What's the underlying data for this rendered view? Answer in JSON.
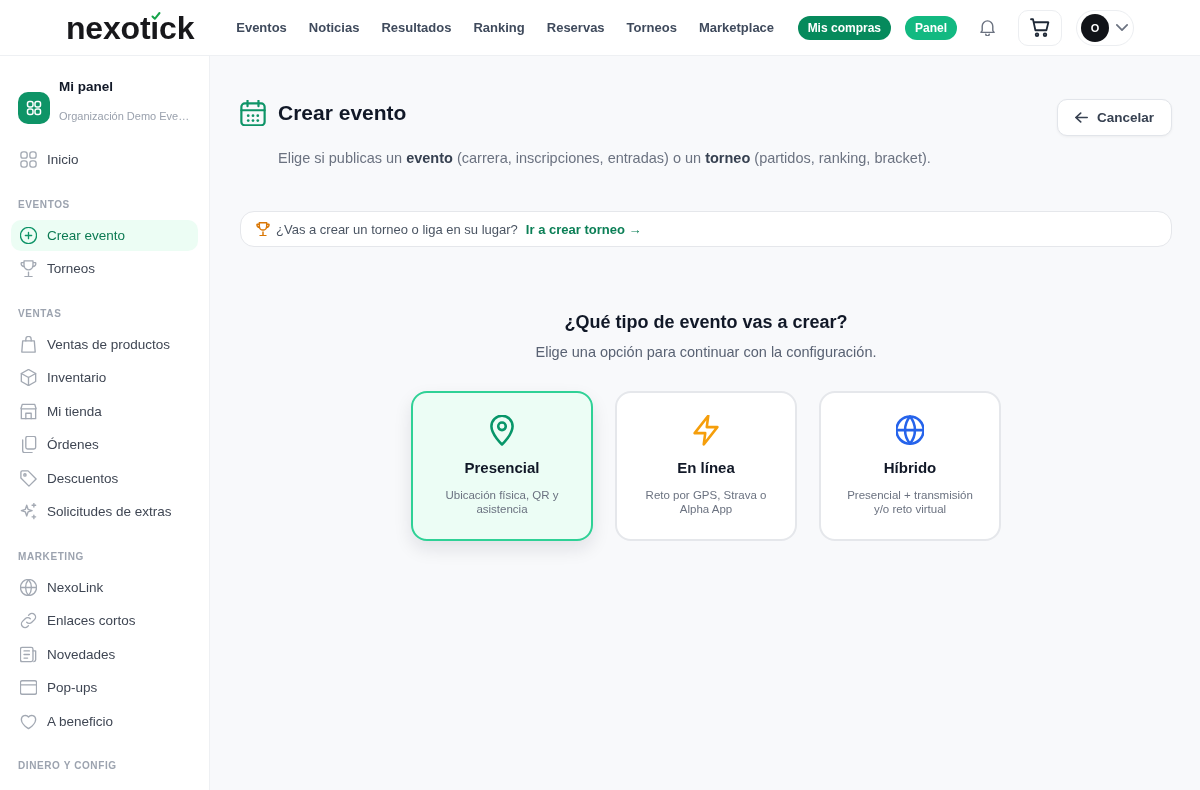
{
  "header": {
    "logo": "nexotick",
    "nav": [
      "Eventos",
      "Noticias",
      "Resultados",
      "Ranking",
      "Reservas",
      "Torneos",
      "Marketplace"
    ],
    "actions": [
      {
        "label": "Mis compras",
        "kind": "primary"
      },
      {
        "label": "Panel",
        "kind": "secondary"
      }
    ],
    "avatar": "O"
  },
  "sidebar": {
    "title": "Mi panel",
    "subtitle": "Organización Demo Eve…",
    "sections": [
      {
        "items": [
          {
            "label": "Inicio",
            "selected": false
          }
        ]
      },
      {
        "label": "EVENTOS",
        "items": [
          {
            "label": "Crear evento",
            "selected": true
          },
          {
            "label": "Torneos",
            "selected": false
          }
        ]
      },
      {
        "label": "VENTAS",
        "items": [
          {
            "label": "Ventas de productos",
            "selected": false
          },
          {
            "label": "Inventario",
            "selected": false
          },
          {
            "label": "Mi tienda",
            "selected": false
          },
          {
            "label": "Órdenes",
            "selected": false
          },
          {
            "label": "Descuentos",
            "selected": false
          },
          {
            "label": "Solicitudes de extras",
            "selected": false
          }
        ]
      },
      {
        "label": "MARKETING",
        "items": [
          {
            "label": "NexoLink",
            "selected": false
          },
          {
            "label": "Enlaces cortos",
            "selected": false
          },
          {
            "label": "Novedades",
            "selected": false
          },
          {
            "label": "Pop-ups",
            "selected": false
          },
          {
            "label": "A beneficio",
            "selected": false
          }
        ]
      },
      {
        "label": "DINERO Y CONFIG"
      }
    ]
  },
  "page": {
    "title": "Crear evento",
    "cancel_button": "Cancelar",
    "subtitle": "Elige si publicas un **evento** (carrera, inscripciones, entradas) o un **torneo** (partidos, ranking, bracket).",
    "notice": {
      "text": "¿Vas a crear un torneo o liga en su lugar?",
      "link": "Ir a crear torneo →"
    },
    "question": {
      "title": "¿Qué tipo de evento vas a crear?",
      "subtitle": "Elige una opción para continuar con la configuración."
    },
    "event_types": [
      {
        "title": "Presencial",
        "description": "Ubicación física, QR y asistencia",
        "selected": true
      },
      {
        "title": "En línea",
        "description": "Reto por GPS, Strava o Alpha App",
        "selected": false
      },
      {
        "title": "Híbrido",
        "description": "Presencial + transmisión y/o reto virtual",
        "selected": false
      }
    ]
  }
}
